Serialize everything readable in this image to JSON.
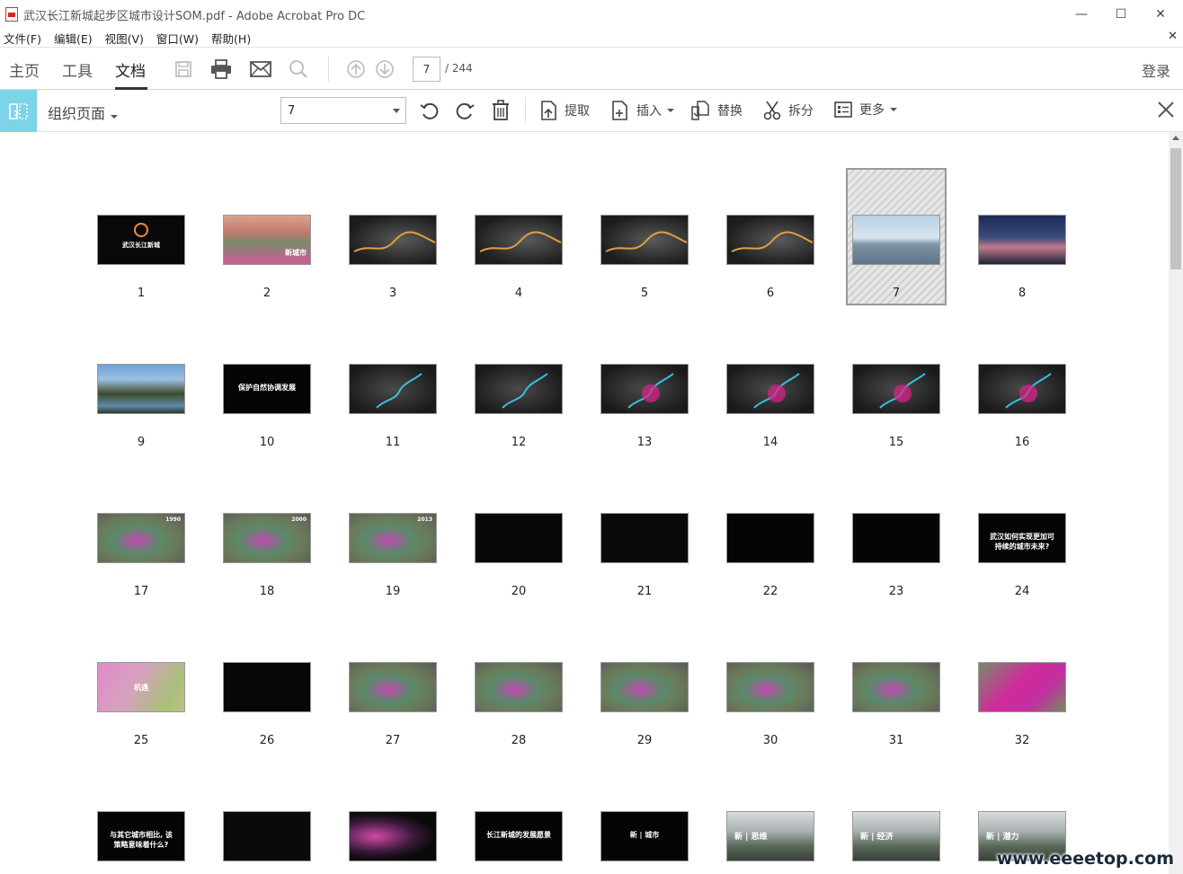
{
  "window": {
    "title": "武汉长江新城起步区城市设计SOM.pdf - Adobe Acrobat Pro DC",
    "controls": {
      "minimize": "—",
      "maximize": "☐",
      "close": "✕"
    }
  },
  "menu": {
    "items": [
      "文件(F)",
      "编辑(E)",
      "视图(V)",
      "窗口(W)",
      "帮助(H)"
    ],
    "close_doc": "✕"
  },
  "toolbar": {
    "tabs": [
      "主页",
      "工具",
      "文档"
    ],
    "active_tab": "文档",
    "page_current": "7",
    "page_total": "/ 244",
    "login": "登录"
  },
  "organize": {
    "title": "组织页面",
    "page_select": "7",
    "buttons": {
      "extract": "提取",
      "insert": "插入",
      "replace": "替换",
      "split": "拆分",
      "more": "更多"
    }
  },
  "thumbnails": {
    "selected": 7,
    "pages": [
      {
        "n": "1",
        "style": "ring",
        "text": "武汉长江新城"
      },
      {
        "n": "2",
        "style": "pinkfield",
        "text": "新城市"
      },
      {
        "n": "3",
        "style": "greymap",
        "text": ""
      },
      {
        "n": "4",
        "style": "greymap",
        "text": ""
      },
      {
        "n": "5",
        "style": "greymap",
        "text": ""
      },
      {
        "n": "6",
        "style": "greymap",
        "text": ""
      },
      {
        "n": "7",
        "style": "sky",
        "text": ""
      },
      {
        "n": "8",
        "style": "bridge",
        "text": ""
      },
      {
        "n": "9",
        "style": "forest",
        "text": ""
      },
      {
        "n": "10",
        "style": "black",
        "text": "保护自然协调发展"
      },
      {
        "n": "11",
        "style": "river",
        "text": ""
      },
      {
        "n": "12",
        "style": "river",
        "text": ""
      },
      {
        "n": "13",
        "style": "riverpink",
        "text": ""
      },
      {
        "n": "14",
        "style": "riverpink",
        "text": ""
      },
      {
        "n": "15",
        "style": "riverpink",
        "text": ""
      },
      {
        "n": "16",
        "style": "riverpink",
        "text": ""
      },
      {
        "n": "17",
        "style": "colormap",
        "text": "1990"
      },
      {
        "n": "18",
        "style": "colormap",
        "text": "2000"
      },
      {
        "n": "19",
        "style": "colormap",
        "text": "2013"
      },
      {
        "n": "20",
        "style": "graph",
        "text": ""
      },
      {
        "n": "21",
        "style": "circles",
        "text": ""
      },
      {
        "n": "22",
        "style": "timeline",
        "text": ""
      },
      {
        "n": "23",
        "style": "cycle",
        "text": ""
      },
      {
        "n": "24",
        "style": "black",
        "text": "武汉如何实现更加可持续的城市未来?"
      },
      {
        "n": "25",
        "style": "pinkgreen",
        "text": "机遇"
      },
      {
        "n": "26",
        "style": "blacktext",
        "text": ""
      },
      {
        "n": "27",
        "style": "colormap",
        "text": ""
      },
      {
        "n": "28",
        "style": "colormap",
        "text": ""
      },
      {
        "n": "29",
        "style": "colormap",
        "text": ""
      },
      {
        "n": "30",
        "style": "colormap",
        "text": ""
      },
      {
        "n": "31",
        "style": "colormap",
        "text": ""
      },
      {
        "n": "32",
        "style": "magenta",
        "text": ""
      },
      {
        "n": "",
        "style": "black",
        "text": "与其它城市相比, 该策略意味着什么?"
      },
      {
        "n": "",
        "style": "circles",
        "text": ""
      },
      {
        "n": "",
        "style": "pinkmap",
        "text": ""
      },
      {
        "n": "",
        "style": "black",
        "text": "长江新城的发展愿景"
      },
      {
        "n": "",
        "style": "black",
        "text": "新 | 城市"
      },
      {
        "n": "",
        "style": "photo",
        "text": "新 | 思维"
      },
      {
        "n": "",
        "style": "photo",
        "text": "新 | 经济"
      },
      {
        "n": "",
        "style": "photo",
        "text": "新 | 潜力"
      }
    ]
  },
  "watermark": "www.eeeetop.com"
}
